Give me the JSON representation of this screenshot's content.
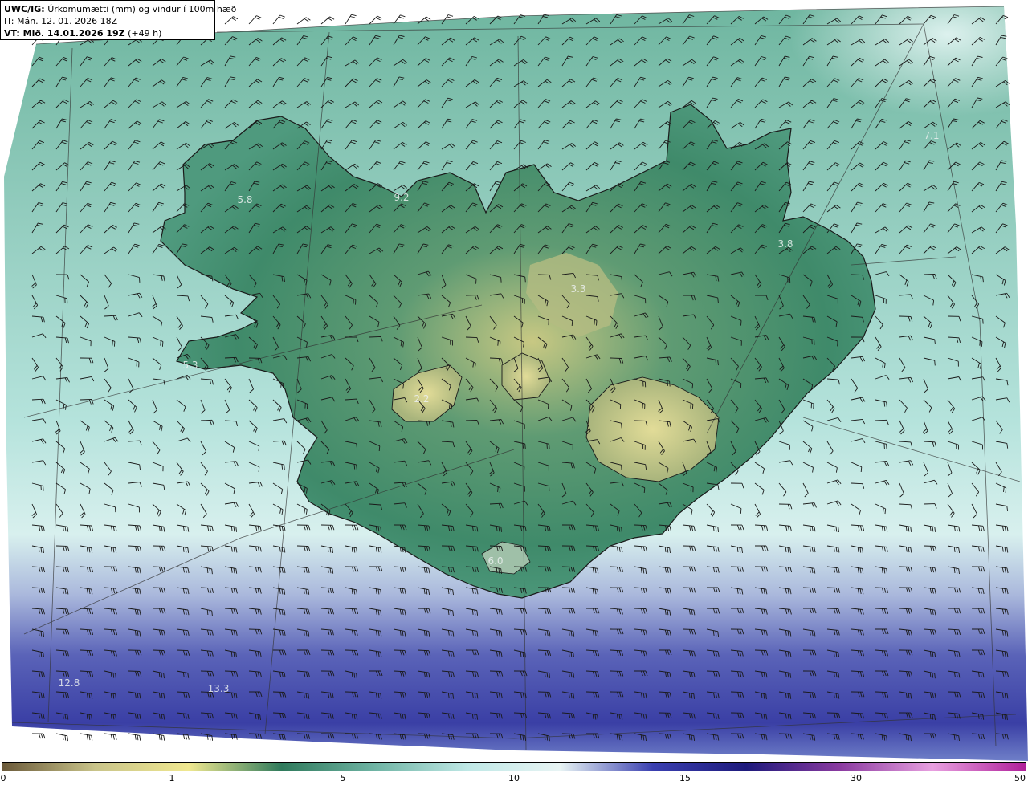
{
  "header": {
    "model": "UWC/IG:",
    "title": "Úrkomumætti (mm) og vindur í 100m hæð",
    "issue_time": "IT: Mán. 12. 01. 2026 18Z",
    "valid_label": "VT: Mið. 14.01.2026 19Z",
    "lead_time": "(+49 h)"
  },
  "value_labels": [
    "5.8",
    "9.2",
    "5.3",
    "2.2",
    "3.3",
    "3.8",
    "7.1",
    "6.0",
    "12.8",
    "13.3"
  ],
  "colorbar": {
    "ticks": [
      "0",
      "1",
      "5",
      "10",
      "15",
      "30",
      "50"
    ],
    "colors": [
      "#6b5a3a",
      "#c9c48a",
      "#f0e890",
      "#2f7a5c",
      "#6fb4a4",
      "#bfe8e6",
      "#e8f4f4",
      "#3a3fb0",
      "#1e1a7c",
      "#8a3aa0",
      "#e8a0e0",
      "#b0209a"
    ]
  }
}
